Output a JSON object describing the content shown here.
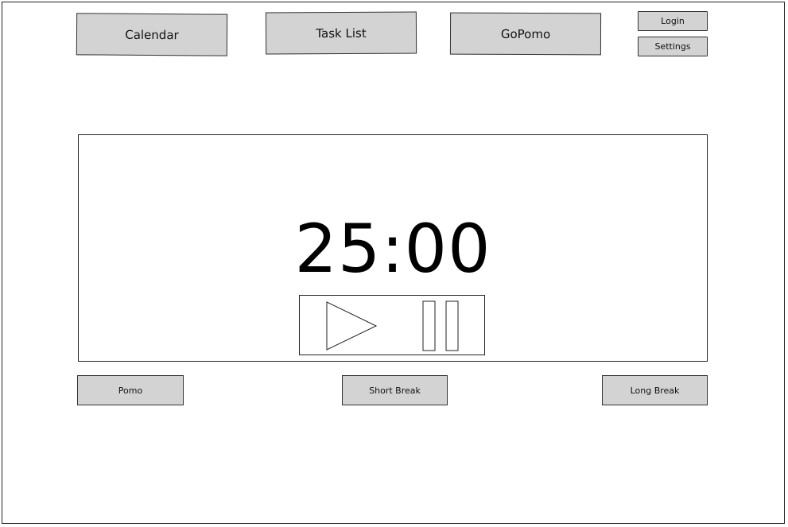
{
  "nav": {
    "calendar": "Calendar",
    "task_list": "Task List",
    "gopomo": "GoPomo"
  },
  "account": {
    "login": "Login",
    "settings": "Settings"
  },
  "timer": {
    "display": "25:00",
    "controls": [
      {
        "name": "play",
        "icon": "play-icon"
      },
      {
        "name": "pause",
        "icon": "pause-icon"
      }
    ]
  },
  "modes": {
    "pomo": "Pomo",
    "short_break": "Short Break",
    "long_break": "Long Break"
  },
  "colors": {
    "button_fill": "#d3d3d3",
    "border": "#222222",
    "background": "#ffffff"
  }
}
